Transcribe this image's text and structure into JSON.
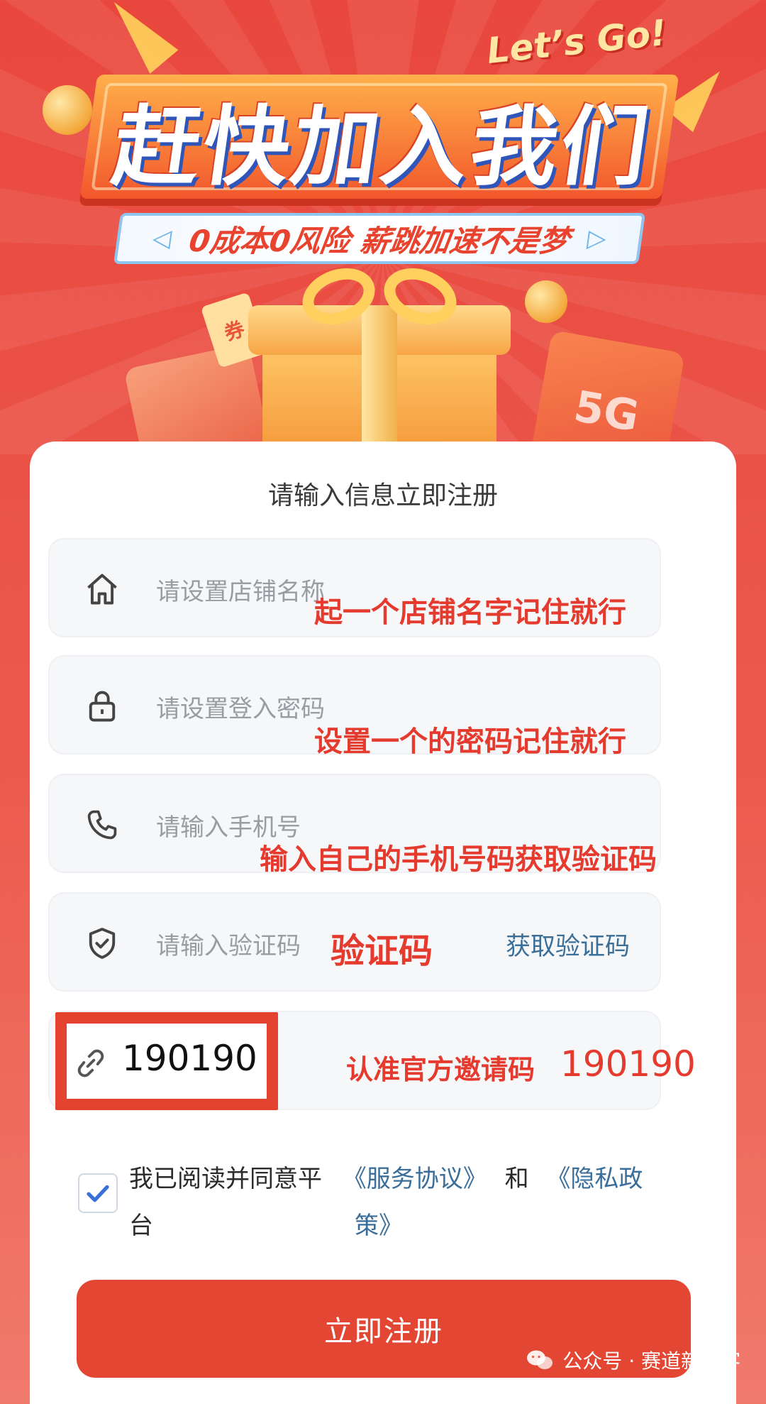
{
  "banner": {
    "lets_go": "Let’s Go!",
    "title": "赶快加入我们",
    "subtitle": "0成本0风险 薪跳加速不是梦",
    "arrow_left": "◁",
    "arrow_right": "▷",
    "coupon_char": "券",
    "card_5g": "5G"
  },
  "form": {
    "header": "请输入信息立即注册",
    "fields": [
      {
        "placeholder": "请设置店铺名称",
        "icon": "home-icon",
        "annotation": "起一个店铺名字记住就行"
      },
      {
        "placeholder": "请设置登入密码",
        "icon": "lock-icon",
        "annotation": "设置一个的密码记住就行"
      },
      {
        "placeholder": "请输入手机号",
        "icon": "phone-icon",
        "annotation": "输入自己的手机号码获取验证码"
      },
      {
        "placeholder": "请输入验证码",
        "icon": "shield-check-icon",
        "annotation": "验证码",
        "action": "获取验证码"
      }
    ],
    "invite": {
      "icon": "link-icon",
      "code": "190190",
      "annotation": "认准官方邀请码",
      "annotation_code": "190190"
    },
    "agreement": {
      "checked": true,
      "text_prefix": "我已阅读并同意平",
      "text_prefix_line2": "台",
      "service_link": "《服务协议》",
      "and": "和",
      "privacy_link_part1": "《隐私政",
      "privacy_link_part2": "策》"
    },
    "submit_label": "立即注册"
  },
  "watermark": {
    "text": "公众号 · 赛道新探客",
    "icon": "wechat-icon"
  },
  "colors": {
    "brand_red": "#e34633",
    "annotation_red": "#e53b2f",
    "link_blue": "#3a6e9a"
  }
}
